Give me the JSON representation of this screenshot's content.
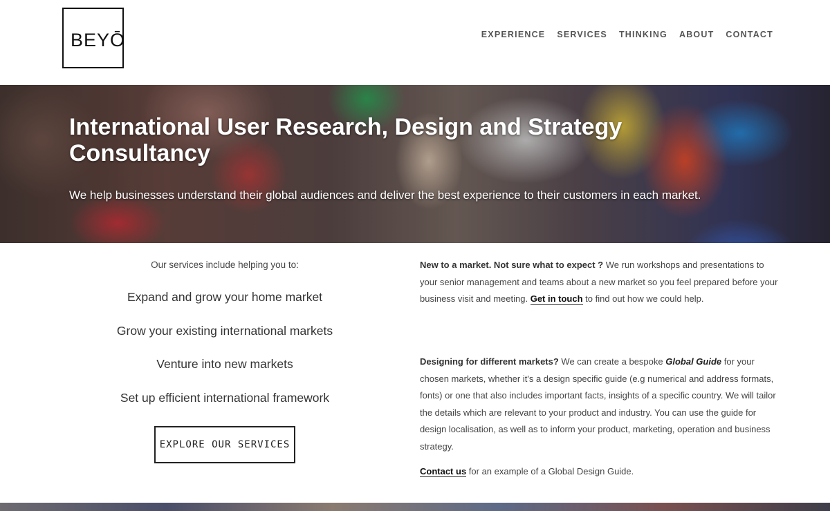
{
  "header": {
    "logo_text": "BEYŌ",
    "nav": [
      {
        "label": "EXPERIENCE"
      },
      {
        "label": "SERVICES"
      },
      {
        "label": "THINKING"
      },
      {
        "label": "ABOUT"
      },
      {
        "label": "CONTACT"
      }
    ]
  },
  "hero": {
    "title": "International User Research, Design and Strategy Consultancy",
    "subtitle": "We help businesses understand their global audiences and deliver the best experience to their customers in each market."
  },
  "services": {
    "intro": "Our services include helping you to:",
    "items": [
      {
        "label": "Expand and grow your home market"
      },
      {
        "label": "Grow your existing international markets"
      },
      {
        "label": "Venture into new markets"
      },
      {
        "label": "Set up efficient international framework"
      }
    ],
    "button_label": "EXPLORE OUR SERVICES"
  },
  "info": {
    "para1": {
      "lead": "New to a market. Not sure what to expect ?",
      "text": " We run workshops and presentations to your senior management and teams about a new market so you feel prepared before your business visit and meeting. ",
      "link": "Get in touch",
      "tail": " to find out how we could help."
    },
    "para2": {
      "lead": "Designing for different markets?",
      "text1": " We can create a bespoke ",
      "emphasis": "Global Guide",
      "text2": " for your chosen markets,  whether it's a design specific guide (e.g numerical and address formats, fonts) or one that also includes important facts, insights of a specific country. We will tailor the details which are relevant to your product and industry. You can use the guide for design localisation, as well as to inform your product, marketing, operation and business strategy."
    },
    "para3": {
      "link": "Contact us",
      "tail": " for an example of a Global Design Guide."
    }
  }
}
